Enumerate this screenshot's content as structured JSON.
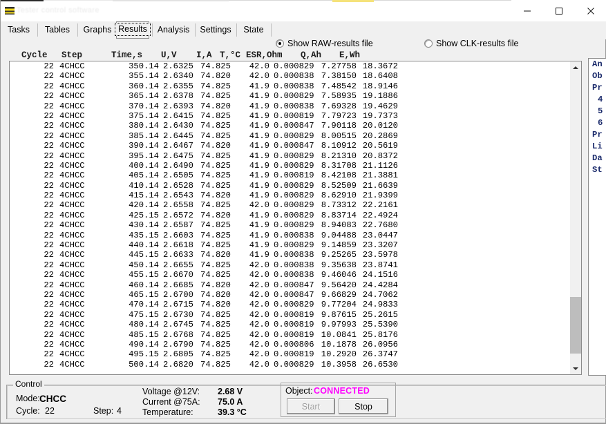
{
  "window": {
    "title": "Tester control software",
    "minimize_label": "Minimize",
    "maximize_label": "Maximize",
    "close_label": "Close"
  },
  "tabs": [
    {
      "label": "Tasks",
      "selected": false
    },
    {
      "label": "Tables",
      "selected": false
    },
    {
      "label": "Graphs",
      "selected": false
    },
    {
      "label": "Results",
      "selected": true
    },
    {
      "label": "Analysis",
      "selected": false
    },
    {
      "label": "Settings",
      "selected": false
    },
    {
      "label": "State",
      "selected": false
    }
  ],
  "file_options": {
    "raw": {
      "label": "Show RAW-results file",
      "selected": true
    },
    "clk": {
      "label": "Show CLK-results file",
      "selected": false
    }
  },
  "table": {
    "columns": [
      "Cycle",
      "Step",
      "Time,s",
      "U,V",
      "I,A",
      "T,°C",
      "ESR,Ohm",
      "Q,Ah",
      "E,Wh"
    ],
    "rows": [
      [
        "22",
        "4CHCC",
        "350.14",
        "2.6325",
        "74.825",
        "42.0",
        "0.000829",
        "7.27758",
        "18.3672"
      ],
      [
        "22",
        "4CHCC",
        "355.14",
        "2.6340",
        "74.820",
        "42.0",
        "0.000838",
        "7.38150",
        "18.6408"
      ],
      [
        "22",
        "4CHCC",
        "360.14",
        "2.6355",
        "74.825",
        "41.9",
        "0.000838",
        "7.48542",
        "18.9146"
      ],
      [
        "22",
        "4CHCC",
        "365.14",
        "2.6378",
        "74.825",
        "41.9",
        "0.000829",
        "7.58935",
        "19.1886"
      ],
      [
        "22",
        "4CHCC",
        "370.14",
        "2.6393",
        "74.820",
        "41.9",
        "0.000838",
        "7.69328",
        "19.4629"
      ],
      [
        "22",
        "4CHCC",
        "375.14",
        "2.6415",
        "74.825",
        "41.9",
        "0.000819",
        "7.79723",
        "19.7373"
      ],
      [
        "22",
        "4CHCC",
        "380.14",
        "2.6430",
        "74.825",
        "41.9",
        "0.000847",
        "7.90118",
        "20.0120"
      ],
      [
        "22",
        "4CHCC",
        "385.14",
        "2.6445",
        "74.825",
        "41.9",
        "0.000829",
        "8.00515",
        "20.2869"
      ],
      [
        "22",
        "4CHCC",
        "390.14",
        "2.6467",
        "74.820",
        "41.9",
        "0.000847",
        "8.10912",
        "20.5619"
      ],
      [
        "22",
        "4CHCC",
        "395.14",
        "2.6475",
        "74.825",
        "41.9",
        "0.000829",
        "8.21310",
        "20.8372"
      ],
      [
        "22",
        "4CHCC",
        "400.14",
        "2.6490",
        "74.825",
        "41.9",
        "0.000829",
        "8.31708",
        "21.1126"
      ],
      [
        "22",
        "4CHCC",
        "405.14",
        "2.6505",
        "74.825",
        "41.9",
        "0.000819",
        "8.42108",
        "21.3881"
      ],
      [
        "22",
        "4CHCC",
        "410.14",
        "2.6528",
        "74.825",
        "41.9",
        "0.000829",
        "8.52509",
        "21.6639"
      ],
      [
        "22",
        "4CHCC",
        "415.14",
        "2.6543",
        "74.820",
        "41.9",
        "0.000829",
        "8.62910",
        "21.9399"
      ],
      [
        "22",
        "4CHCC",
        "420.14",
        "2.6558",
        "74.825",
        "42.0",
        "0.000829",
        "8.73312",
        "22.2161"
      ],
      [
        "22",
        "4CHCC",
        "425.15",
        "2.6572",
        "74.820",
        "41.9",
        "0.000829",
        "8.83714",
        "22.4924"
      ],
      [
        "22",
        "4CHCC",
        "430.14",
        "2.6587",
        "74.825",
        "41.9",
        "0.000829",
        "8.94083",
        "22.7680"
      ],
      [
        "22",
        "4CHCC",
        "435.15",
        "2.6603",
        "74.825",
        "41.9",
        "0.000838",
        "9.04488",
        "23.0447"
      ],
      [
        "22",
        "4CHCC",
        "440.14",
        "2.6618",
        "74.825",
        "41.9",
        "0.000829",
        "9.14859",
        "23.3207"
      ],
      [
        "22",
        "4CHCC",
        "445.15",
        "2.6633",
        "74.820",
        "41.9",
        "0.000838",
        "9.25265",
        "23.5978"
      ],
      [
        "22",
        "4CHCC",
        "450.14",
        "2.6655",
        "74.825",
        "42.0",
        "0.000838",
        "9.35638",
        "23.8741"
      ],
      [
        "22",
        "4CHCC",
        "455.15",
        "2.6670",
        "74.825",
        "42.0",
        "0.000838",
        "9.46046",
        "24.1516"
      ],
      [
        "22",
        "4CHCC",
        "460.14",
        "2.6685",
        "74.820",
        "42.0",
        "0.000847",
        "9.56420",
        "24.4284"
      ],
      [
        "22",
        "4CHCC",
        "465.15",
        "2.6700",
        "74.820",
        "42.0",
        "0.000847",
        "9.66829",
        "24.7062"
      ],
      [
        "22",
        "4CHCC",
        "470.14",
        "2.6715",
        "74.820",
        "42.0",
        "0.000829",
        "9.77204",
        "24.9833"
      ],
      [
        "22",
        "4CHCC",
        "475.15",
        "2.6730",
        "74.825",
        "42.0",
        "0.000819",
        "9.87615",
        "25.2615"
      ],
      [
        "22",
        "4CHCC",
        "480.14",
        "2.6745",
        "74.825",
        "42.0",
        "0.000819",
        "9.97993",
        "25.5390"
      ],
      [
        "22",
        "4CHCC",
        "485.15",
        "2.6768",
        "74.825",
        "42.0",
        "0.000819",
        "10.0841",
        "25.8176"
      ],
      [
        "22",
        "4CHCC",
        "490.14",
        "2.6790",
        "74.825",
        "42.0",
        "0.000806",
        "10.1878",
        "26.0956"
      ],
      [
        "22",
        "4CHCC",
        "495.15",
        "2.6805",
        "74.825",
        "42.0",
        "0.000819",
        "10.2920",
        "26.3747"
      ],
      [
        "22",
        "4CHCC",
        "500.14",
        "2.6820",
        "74.825",
        "42.0",
        "0.000829",
        "10.3958",
        "26.6530"
      ]
    ]
  },
  "side_panel": {
    "items": [
      "An",
      "Ob",
      "Pr",
      "4",
      "5",
      "6",
      "Pr",
      "Li",
      "Da",
      "St"
    ]
  },
  "scrollbar": {
    "up_icon": "chevron-up-icon",
    "down_icon": "chevron-down-icon"
  },
  "control": {
    "legend": "Control",
    "mode_label": "Mode:",
    "mode_value": "CHCC",
    "cycle_label": "Cycle:",
    "cycle_value": "22",
    "step_label": "Step:",
    "step_value": "4",
    "voltage_label": "Voltage @12V:",
    "voltage_value": "2.68 V",
    "current_label": "Current @75A:",
    "current_value": "75.0 A",
    "temperature_label": "Temperature:",
    "temperature_value": "39.3 °C",
    "object_label": "Object:",
    "object_status": "CONNECTED",
    "object_status_color": "#ff00ff",
    "start_label": "Start",
    "stop_label": "Stop"
  }
}
